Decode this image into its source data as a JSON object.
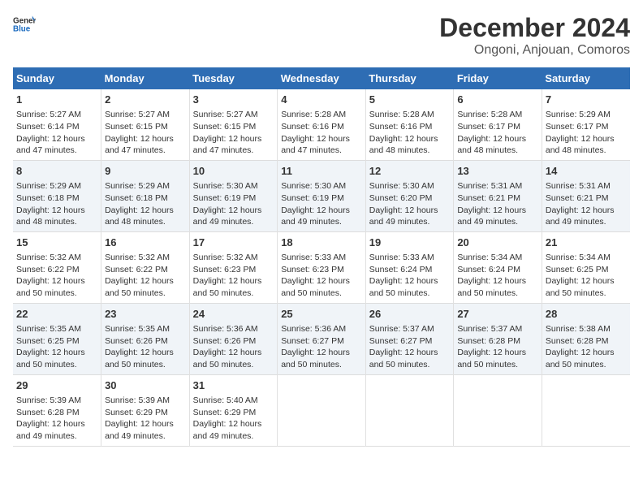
{
  "header": {
    "logo_line1": "General",
    "logo_line2": "Blue",
    "title": "December 2024",
    "subtitle": "Ongoni, Anjouan, Comoros"
  },
  "days_of_week": [
    "Sunday",
    "Monday",
    "Tuesday",
    "Wednesday",
    "Thursday",
    "Friday",
    "Saturday"
  ],
  "weeks": [
    [
      {
        "day": 1,
        "sunrise": "5:27 AM",
        "sunset": "6:14 PM",
        "daylight": "12 hours and 47 minutes."
      },
      {
        "day": 2,
        "sunrise": "5:27 AM",
        "sunset": "6:15 PM",
        "daylight": "12 hours and 47 minutes."
      },
      {
        "day": 3,
        "sunrise": "5:27 AM",
        "sunset": "6:15 PM",
        "daylight": "12 hours and 47 minutes."
      },
      {
        "day": 4,
        "sunrise": "5:28 AM",
        "sunset": "6:16 PM",
        "daylight": "12 hours and 47 minutes."
      },
      {
        "day": 5,
        "sunrise": "5:28 AM",
        "sunset": "6:16 PM",
        "daylight": "12 hours and 48 minutes."
      },
      {
        "day": 6,
        "sunrise": "5:28 AM",
        "sunset": "6:17 PM",
        "daylight": "12 hours and 48 minutes."
      },
      {
        "day": 7,
        "sunrise": "5:29 AM",
        "sunset": "6:17 PM",
        "daylight": "12 hours and 48 minutes."
      }
    ],
    [
      {
        "day": 8,
        "sunrise": "5:29 AM",
        "sunset": "6:18 PM",
        "daylight": "12 hours and 48 minutes."
      },
      {
        "day": 9,
        "sunrise": "5:29 AM",
        "sunset": "6:18 PM",
        "daylight": "12 hours and 48 minutes."
      },
      {
        "day": 10,
        "sunrise": "5:30 AM",
        "sunset": "6:19 PM",
        "daylight": "12 hours and 49 minutes."
      },
      {
        "day": 11,
        "sunrise": "5:30 AM",
        "sunset": "6:19 PM",
        "daylight": "12 hours and 49 minutes."
      },
      {
        "day": 12,
        "sunrise": "5:30 AM",
        "sunset": "6:20 PM",
        "daylight": "12 hours and 49 minutes."
      },
      {
        "day": 13,
        "sunrise": "5:31 AM",
        "sunset": "6:21 PM",
        "daylight": "12 hours and 49 minutes."
      },
      {
        "day": 14,
        "sunrise": "5:31 AM",
        "sunset": "6:21 PM",
        "daylight": "12 hours and 49 minutes."
      }
    ],
    [
      {
        "day": 15,
        "sunrise": "5:32 AM",
        "sunset": "6:22 PM",
        "daylight": "12 hours and 50 minutes."
      },
      {
        "day": 16,
        "sunrise": "5:32 AM",
        "sunset": "6:22 PM",
        "daylight": "12 hours and 50 minutes."
      },
      {
        "day": 17,
        "sunrise": "5:32 AM",
        "sunset": "6:23 PM",
        "daylight": "12 hours and 50 minutes."
      },
      {
        "day": 18,
        "sunrise": "5:33 AM",
        "sunset": "6:23 PM",
        "daylight": "12 hours and 50 minutes."
      },
      {
        "day": 19,
        "sunrise": "5:33 AM",
        "sunset": "6:24 PM",
        "daylight": "12 hours and 50 minutes."
      },
      {
        "day": 20,
        "sunrise": "5:34 AM",
        "sunset": "6:24 PM",
        "daylight": "12 hours and 50 minutes."
      },
      {
        "day": 21,
        "sunrise": "5:34 AM",
        "sunset": "6:25 PM",
        "daylight": "12 hours and 50 minutes."
      }
    ],
    [
      {
        "day": 22,
        "sunrise": "5:35 AM",
        "sunset": "6:25 PM",
        "daylight": "12 hours and 50 minutes."
      },
      {
        "day": 23,
        "sunrise": "5:35 AM",
        "sunset": "6:26 PM",
        "daylight": "12 hours and 50 minutes."
      },
      {
        "day": 24,
        "sunrise": "5:36 AM",
        "sunset": "6:26 PM",
        "daylight": "12 hours and 50 minutes."
      },
      {
        "day": 25,
        "sunrise": "5:36 AM",
        "sunset": "6:27 PM",
        "daylight": "12 hours and 50 minutes."
      },
      {
        "day": 26,
        "sunrise": "5:37 AM",
        "sunset": "6:27 PM",
        "daylight": "12 hours and 50 minutes."
      },
      {
        "day": 27,
        "sunrise": "5:37 AM",
        "sunset": "6:28 PM",
        "daylight": "12 hours and 50 minutes."
      },
      {
        "day": 28,
        "sunrise": "5:38 AM",
        "sunset": "6:28 PM",
        "daylight": "12 hours and 50 minutes."
      }
    ],
    [
      {
        "day": 29,
        "sunrise": "5:39 AM",
        "sunset": "6:28 PM",
        "daylight": "12 hours and 49 minutes."
      },
      {
        "day": 30,
        "sunrise": "5:39 AM",
        "sunset": "6:29 PM",
        "daylight": "12 hours and 49 minutes."
      },
      {
        "day": 31,
        "sunrise": "5:40 AM",
        "sunset": "6:29 PM",
        "daylight": "12 hours and 49 minutes."
      },
      null,
      null,
      null,
      null
    ]
  ]
}
